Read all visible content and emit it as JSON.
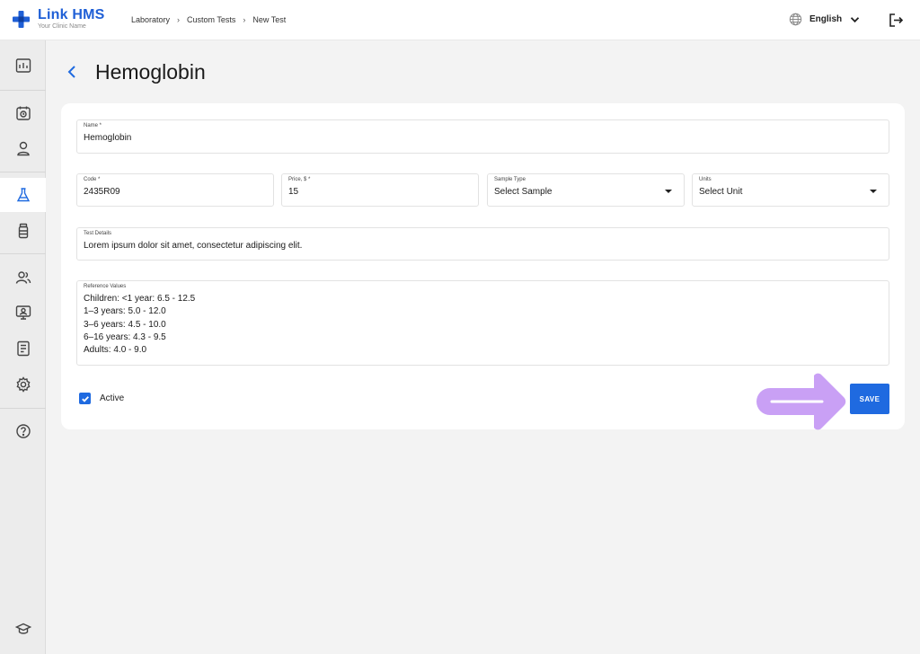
{
  "app": {
    "name": "Link HMS",
    "subtitle": "Your Clinic Name"
  },
  "breadcrumb": [
    "Laboratory",
    "Custom Tests",
    "New Test"
  ],
  "header": {
    "language": "English"
  },
  "sidebar": {
    "items": [
      {
        "icon": "dashboard-icon"
      },
      {
        "icon": "calendar-clock-icon"
      },
      {
        "icon": "user-icon"
      },
      {
        "icon": "flask-icon",
        "active": true
      },
      {
        "icon": "medicine-bottle-icon"
      },
      {
        "icon": "users-group-icon"
      },
      {
        "icon": "monitor-user-icon"
      },
      {
        "icon": "report-document-icon"
      },
      {
        "icon": "gear-icon"
      },
      {
        "icon": "help-icon"
      },
      {
        "icon": "graduation-cap-icon"
      }
    ]
  },
  "page": {
    "title": "Hemoglobin"
  },
  "form": {
    "name": {
      "label": "Name *",
      "value": "Hemoglobin"
    },
    "code": {
      "label": "Code *",
      "value": "2435R09"
    },
    "price": {
      "label": "Price, $ *",
      "value": "15"
    },
    "sample_type": {
      "label": "Sample Type",
      "value": "Select Sample"
    },
    "units": {
      "label": "Units",
      "value": "Select Unit"
    },
    "test_details": {
      "label": "Test Details",
      "value": "Lorem ipsum dolor sit amet, consectetur adipiscing elit."
    },
    "reference_values": {
      "label": "Reference Values",
      "lines": [
        "Children: <1 year: 6.5 - 12.5",
        "1–3 years: 5.0 - 12.0",
        "3–6 years: 4.5 - 10.0",
        "6–16 years: 4.3 - 9.5",
        "Adults: 4.0 - 9.0"
      ]
    },
    "active": {
      "label": "Active",
      "checked": true
    },
    "save_label": "SAVE"
  },
  "colors": {
    "brand": "#1f5fd6",
    "primary": "#1f6ae0",
    "highlight_arrow": "#c9a0f5"
  }
}
